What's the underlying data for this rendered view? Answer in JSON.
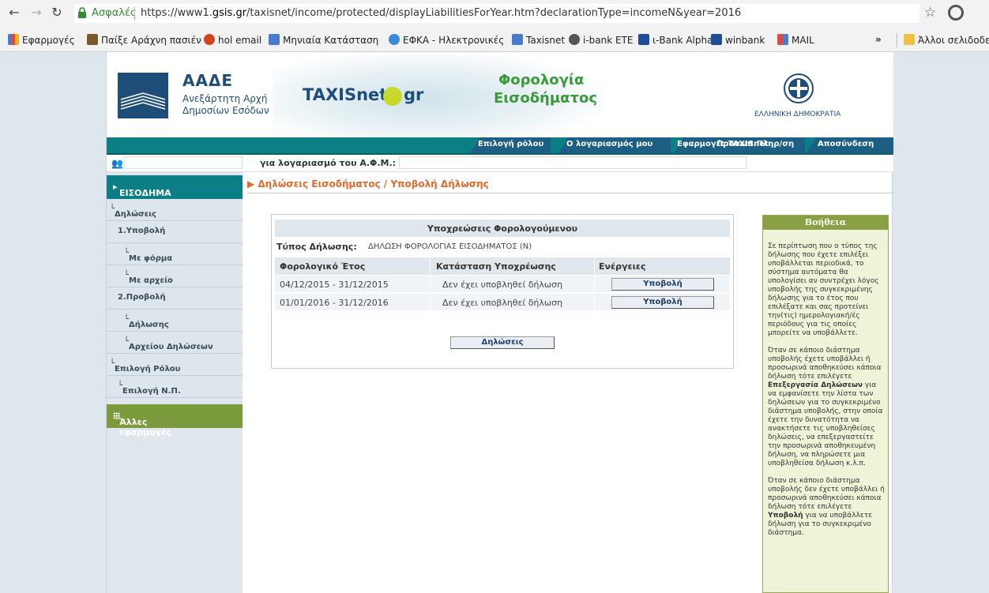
{
  "browser": {
    "secure_label": "Ασφαλές",
    "url_prefix": "https://www1.",
    "url_domain": "gsis.gr",
    "url_path": "/taxisnet/income/protected/displayLiabilitiesForYear.htm?declarationType=incomeN&year=2016",
    "bookmarks": [
      {
        "label": "Εφαρμογές",
        "color": "#4a7bd0"
      },
      {
        "label": "Παίξε Αράχνη πασιέν",
        "color": "#7a5a2a"
      },
      {
        "label": "hol email",
        "color": "#d0451b"
      },
      {
        "label": "Μηνιαία Κατάσταση",
        "color": "#4a7bd0"
      },
      {
        "label": "ΕΦΚΑ - Ηλεκτρονικές",
        "color": "#3a8ad8"
      },
      {
        "label": "Taxisnet",
        "color": "#4a7bd0"
      },
      {
        "label": "i-bank ΕΤΕ",
        "color": "#555555"
      },
      {
        "label": "ι-Bank Alpha",
        "color": "#1f4d9a"
      },
      {
        "label": "winbank",
        "color": "#1f4d9a"
      },
      {
        "label": "MAIL",
        "color": "#e0a010"
      }
    ],
    "more_label": "»",
    "other_bookmarks": "Άλλοι σελιδοδείκ"
  },
  "header": {
    "aade_title": "ΑΑΔΕ",
    "aade_sub1": "Ανεξάρτητη Αρχή",
    "aade_sub2": "Δημοσίων Εσόδων",
    "taxisnet": "TAXISnet",
    "taxisnet_gr": "gr",
    "app_title_line1": "Φορολογία",
    "app_title_line2": "Εισοδήματος",
    "emblem_text": "ΕΛΛΗΝΙΚΗ ΔΗΜΟΚΡΑΤΙΑ"
  },
  "topnav": {
    "items": [
      "Επιλογή ρόλου",
      "Ο λογαριασμός μου",
      "Εφαρμογές TAXISnet",
      "Προσωπ.Πληρ/ση",
      "Αποσύνδεση"
    ]
  },
  "afm": {
    "label": "για λογαριασμό του Α.Φ.Μ.:"
  },
  "sidebar": {
    "header": "ΕΙΣΟΔΗΜΑ",
    "items": [
      {
        "label": "Δηλώσεις"
      },
      {
        "label": "1.Υποβολή"
      },
      {
        "label": "Με φόρμα"
      },
      {
        "label": "Με αρχείο"
      },
      {
        "label": "2.Προβολή"
      },
      {
        "label": "Δήλωσης"
      },
      {
        "label": "Αρχείου Δηλώσεων"
      },
      {
        "label": "Επιλογή Ρόλου"
      },
      {
        "label": "Επιλογή Ν.Π."
      }
    ],
    "other_apps": "Άλλες εφαρμογές"
  },
  "breadcrumb": "Δηλώσεις Εισοδήματος / Υποβολή Δήλωσης",
  "panel": {
    "title": "Υποχρεώσεις Φορολογούμενου",
    "decl_label": "Τύπος Δήλωσης:",
    "decl_value": "ΔΗΛΩΣΗ ΦΟΡΟΛΟΓΙΑΣ ΕΙΣΟΔΗΜΑΤΟΣ (Ν)",
    "columns": [
      "Φορολογικό Έτος",
      "Κατάσταση Υποχρέωσης",
      "Ενέργειες"
    ],
    "rows": [
      {
        "year": "04/12/2015 - 31/12/2015",
        "status": "Δεν έχει υποβληθεί δήλωση",
        "action": "Υποβολή"
      },
      {
        "year": "01/01/2016 - 31/12/2016",
        "status": "Δεν έχει υποβληθεί δήλωση",
        "action": "Υποβολή"
      }
    ],
    "declarations_button": "Δηλώσεις"
  },
  "help": {
    "title": "Βοήθεια",
    "p1": "Σε περίπτωση που ο τύπος της δήλωσης που έχετε επιλέξει υποβάλλεται περιοδικά, το σύστημα αυτόματα θα υπολογίσει αν συντρέχει λόγος υποβολής της συγκεκριμένης δήλωσης για το έτος που επιλέξατε και σας προτείνει την(τις) ημερολογιακή/ές περιόδους για τις οποίες μπορείτε να υποβάλλετε.",
    "p2_a": "Όταν σε κάποιο διάστημα υποβολής έχετε υποβάλλει ή προσωρινά αποθηκεύσει κάποια δήλωση τότε επιλέγετε ",
    "p2_bold": "Επεξεργασία Δηλώσεων",
    "p2_b": " για να εμφανίσετε την λίστα των δηλώσεων για το συγκεκριμένο διάστημα υποβολής, στην οποία έχετε την δυνατότητα να ανακτήσετε τις υποβληθείσες δηλώσεις, να επεξεργαστείτε την προσωρινά αποθηκευμένη δήλωση, να πληρώσετε μια υποβληθείσα δήλωση κ.λ.π.",
    "p3_a": "Όταν σε κάποιο διάστημα υποβολής δεν έχετε υποβάλλει ή προσωρινά αποθηκεύσει κάποια δήλωση τότε επιλέγετε ",
    "p3_bold": "Υποβολή",
    "p3_b": " για να υποβάλλετε δήλωση για το συγκεκριμένο διάστημα."
  }
}
